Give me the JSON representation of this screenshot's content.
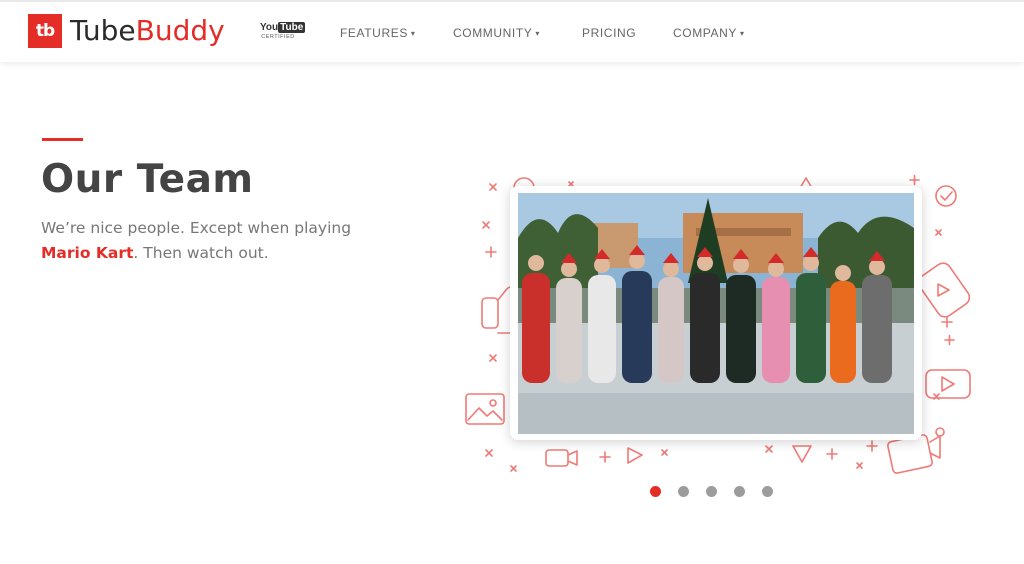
{
  "brand": {
    "logo_mark": "tb",
    "name_part1": "Tube",
    "name_part2": "Buddy",
    "badge_word1": "You",
    "badge_word2": "Tube",
    "badge_sub": "CERTIFIED",
    "color": "#e52d27"
  },
  "nav": {
    "items": [
      {
        "label": "FEATURES",
        "has_dropdown": true
      },
      {
        "label": "COMMUNITY",
        "has_dropdown": true
      },
      {
        "label": "PRICING",
        "has_dropdown": false
      },
      {
        "label": "COMPANY",
        "has_dropdown": true
      }
    ],
    "caret": "▾"
  },
  "hero": {
    "title": "Our Team",
    "subtitle_part1": "We’re nice people. Except when playing ",
    "subtitle_highlight": "Mario Kart",
    "subtitle_part2": ". Then watch out."
  },
  "carousel": {
    "slide_count": 5,
    "active_index": 0,
    "photo_content": "team-group-photo"
  },
  "colors": {
    "accent": "#e52d27",
    "dot_inactive": "#9c9c9c",
    "title_text": "#444444",
    "body_text": "#777777"
  }
}
